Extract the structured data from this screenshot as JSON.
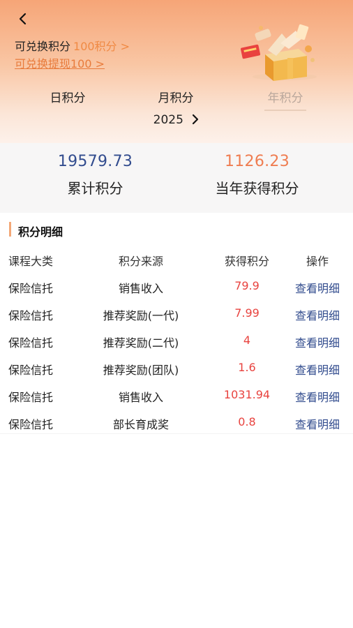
{
  "header": {
    "points_label": "可兑换积分",
    "points_value": "100积分 >",
    "withdraw_link": "可兑换提现100 >"
  },
  "tabs": [
    {
      "label": "日积分"
    },
    {
      "label": "月积分"
    },
    {
      "label": "年积分",
      "active": true
    }
  ],
  "year": "2025",
  "summary": {
    "total_value": "19579.73",
    "total_label": "累计积分",
    "year_value": "1126.23",
    "year_label": "当年获得积分"
  },
  "detail": {
    "title": "积分明细",
    "columns": [
      "课程大类",
      "积分来源",
      "获得积分",
      "操作"
    ],
    "rows": [
      {
        "category": "保险信托",
        "source": "销售收入",
        "points": "79.9",
        "action": "查看明细"
      },
      {
        "category": "保险信托",
        "source": "推荐奖励(一代)",
        "points": "7.99",
        "action": "查看明细"
      },
      {
        "category": "保险信托",
        "source": "推荐奖励(二代)",
        "points": "4",
        "action": "查看明细"
      },
      {
        "category": "保险信托",
        "source": "推荐奖励(团队)",
        "points": "1.6",
        "action": "查看明细"
      },
      {
        "category": "保险信托",
        "source": "销售收入",
        "points": "1031.94",
        "action": "查看明细"
      },
      {
        "category": "保险信托",
        "source": "部长育成奖",
        "points": "0.8",
        "action": "查看明细"
      }
    ]
  },
  "colors": {
    "accent_orange": "#f08a44",
    "value_blue": "#324c8e",
    "points_red": "#e8433f"
  }
}
